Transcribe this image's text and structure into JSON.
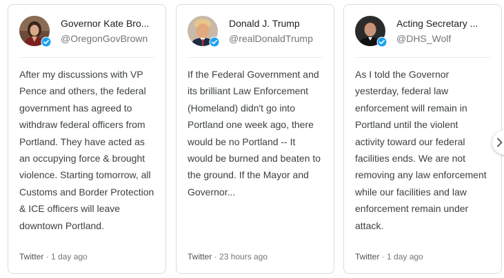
{
  "tweets": [
    {
      "display_name": "Governor Kate Bro...",
      "handle": "@OregonGovBrown",
      "avatar_icon": "profile-photo-woman",
      "verified_icon": "verified-badge-icon",
      "text": "After my discussions with VP Pence and others, the federal government has agreed to withdraw federal officers from Portland. They have acted as an occupying force & brought violence. Starting tomorrow, all Customs and Border Protection & ICE officers will leave downtown Portland.",
      "source": "Twitter",
      "separator": " · ",
      "time": "1 day ago"
    },
    {
      "display_name": "Donald J. Trump",
      "handle": "@realDonaldTrump",
      "avatar_icon": "profile-photo-man",
      "verified_icon": "verified-badge-icon",
      "text": "If the Federal Government and its brilliant Law Enforcement (Homeland) didn't go into Portland one week ago, there would be no Portland -- It would be burned and beaten to the ground. If the Mayor and Governor...",
      "source": "Twitter",
      "separator": " · ",
      "time": "23 hours ago"
    },
    {
      "display_name": "Acting Secretary ...",
      "handle": "@DHS_Wolf",
      "avatar_icon": "profile-photo-man",
      "verified_icon": "verified-badge-icon",
      "text": "As I told the Governor yesterday, federal law enforcement will remain in Portland until the violent activity toward our federal facilities ends. We are not removing any law enforcement while our facilities and law enforcement remain under attack.",
      "source": "Twitter",
      "separator": " · ",
      "time": "1 day ago"
    }
  ],
  "carousel": {
    "next_icon": "chevron-right-icon"
  },
  "colors": {
    "verified_blue": "#1da1f2",
    "text_primary": "#202124",
    "text_secondary": "#70757a",
    "border": "#dadce0"
  }
}
